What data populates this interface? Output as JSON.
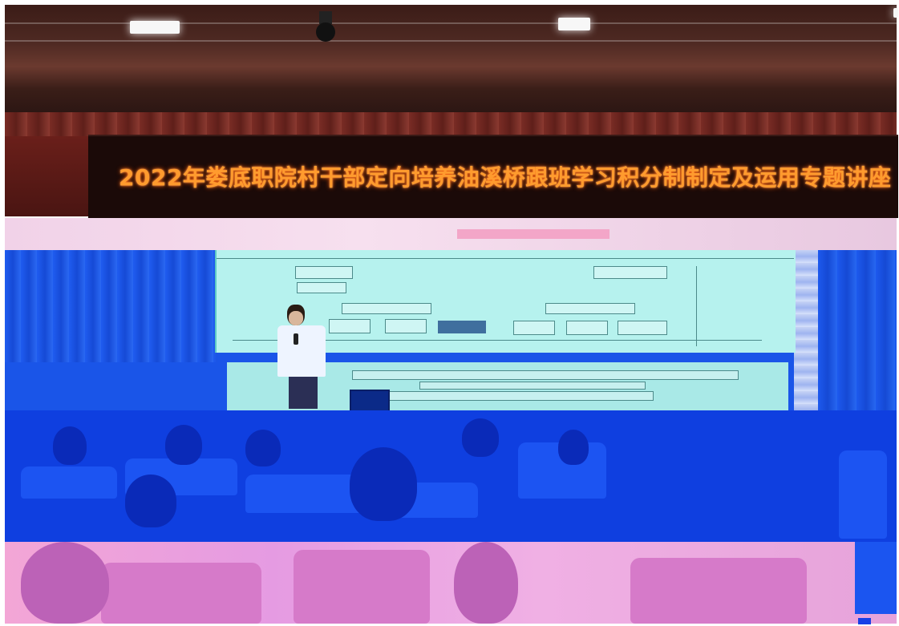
{
  "banner": {
    "text": "2022年娄底职院村干部定向培养油溪桥跟班学习积分制制定及运用专题讲座"
  },
  "colors": {
    "banner_text": "#ff9b2e",
    "banner_bg": "#1b0a08",
    "stage_blue": "#1a55e8",
    "screen": "#b6f2ee",
    "bottom_pink": "#f3a6d6"
  },
  "icons": [
    "security-camera-icon",
    "ceiling-light-icon",
    "microphone-icon",
    "laptop-icon"
  ]
}
